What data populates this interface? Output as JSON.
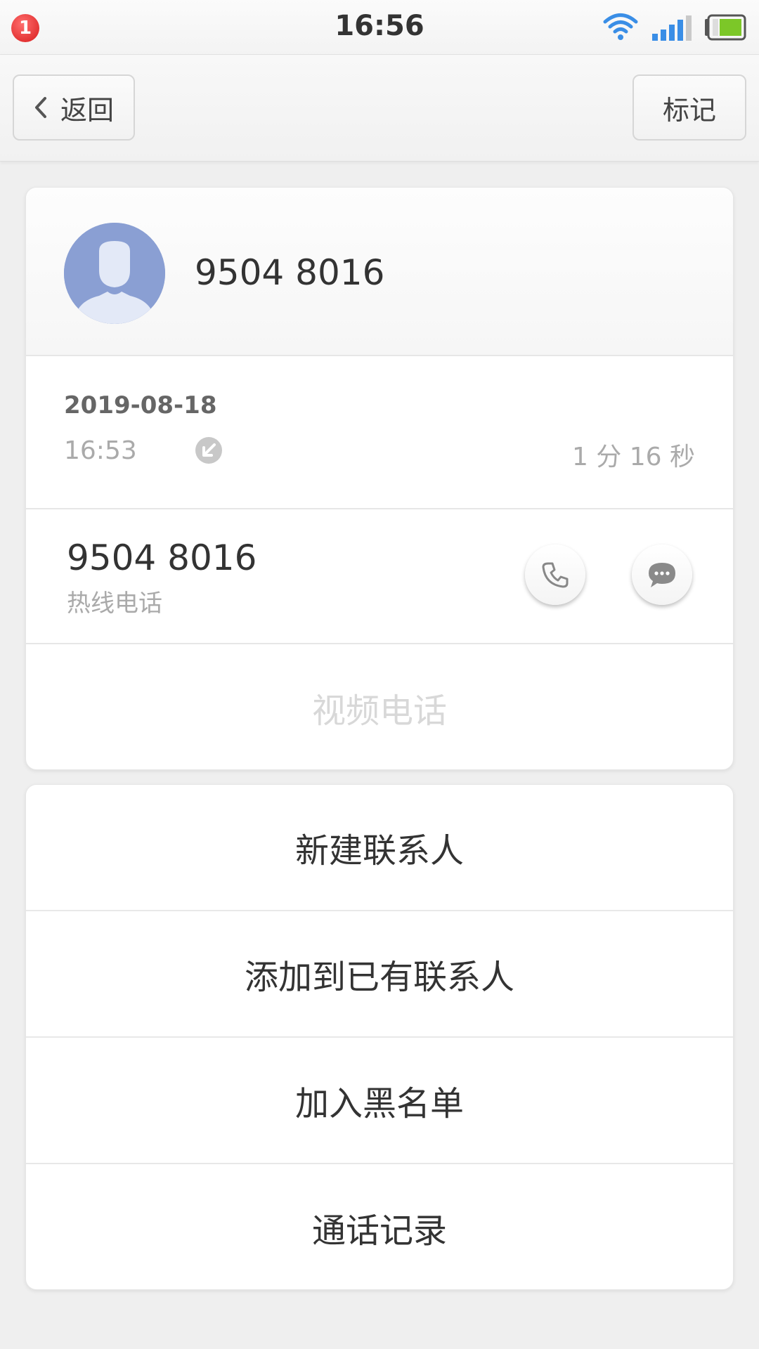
{
  "status_bar": {
    "notification_count": "1",
    "time": "16:56",
    "icons": [
      "wifi-icon",
      "signal-icon",
      "battery-icon"
    ]
  },
  "nav": {
    "back_label": "返回",
    "mark_label": "标记"
  },
  "contact": {
    "number": "9504 8016"
  },
  "call_log": {
    "date": "2019-08-18",
    "time": "16:53",
    "direction_icon": "incoming-call-icon",
    "duration": "1 分 16 秒"
  },
  "phone": {
    "number": "9504 8016",
    "label": "热线电话"
  },
  "video_call_label": "视频电话",
  "actions": [
    {
      "label": "新建联系人"
    },
    {
      "label": "添加到已有联系人"
    },
    {
      "label": "加入黑名单"
    },
    {
      "label": "通话记录"
    }
  ],
  "colors": {
    "badge": "#e02424",
    "wifi": "#3a8ee6",
    "battery": "#7cc728",
    "avatar_bg": "#8a9fd3"
  }
}
